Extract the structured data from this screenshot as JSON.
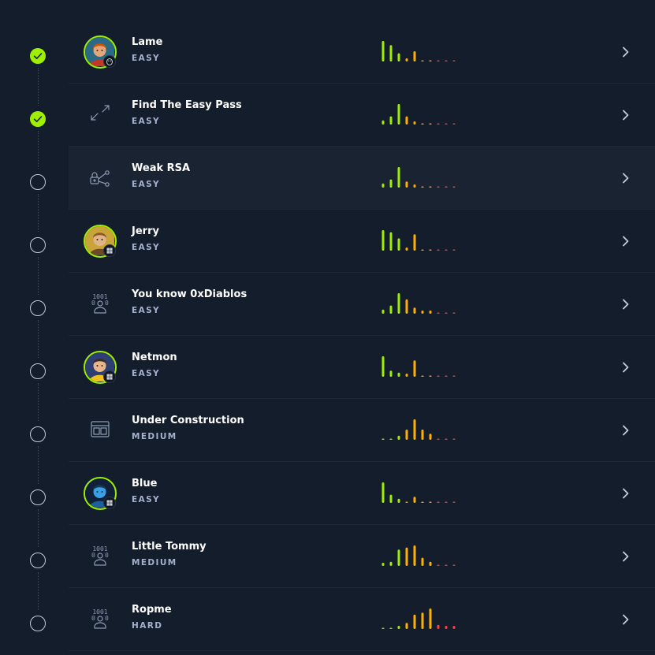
{
  "colors": {
    "background": "#141d2b",
    "highlight_row": "#1a2332",
    "accent_green": "#9fef00",
    "rating_green": "#9fef00",
    "rating_orange": "#ffaf00",
    "rating_red": "#ff3e3e",
    "title_text": "#ffffff",
    "difficulty_text": "#a4b1cd"
  },
  "items": [
    {
      "name": "Lame",
      "difficulty": "EASY",
      "completed": true,
      "icon": "lame-avatar",
      "os": "linux-icon",
      "rating": [
        10,
        8,
        4,
        1,
        5,
        0,
        0,
        0,
        0,
        0
      ]
    },
    {
      "name": "Find The Easy Pass",
      "difficulty": "EASY",
      "completed": true,
      "icon": "reversing-arrows-icon",
      "rating": [
        2,
        4,
        10,
        4,
        1,
        0,
        0,
        0,
        0,
        0
      ]
    },
    {
      "name": "Weak RSA",
      "difficulty": "EASY",
      "completed": false,
      "icon": "crypto-lock-icon",
      "highlighted": true,
      "rating": [
        2,
        4,
        10,
        3,
        1,
        0,
        0,
        0,
        0,
        0
      ]
    },
    {
      "name": "Jerry",
      "difficulty": "EASY",
      "completed": false,
      "icon": "jerry-avatar",
      "os": "windows-icon",
      "rating": [
        10,
        9,
        6,
        1,
        8,
        0,
        0,
        0,
        0,
        0
      ]
    },
    {
      "name": "You know 0xDiablos",
      "difficulty": "EASY",
      "completed": false,
      "icon": "pwn-binary-icon",
      "rating": [
        2,
        4,
        10,
        7,
        3,
        1,
        1,
        0,
        0,
        0
      ]
    },
    {
      "name": "Netmon",
      "difficulty": "EASY",
      "completed": false,
      "icon": "netmon-avatar",
      "os": "windows-icon",
      "rating": [
        10,
        3,
        2,
        1,
        8,
        0,
        0,
        0,
        0,
        0
      ]
    },
    {
      "name": "Under Construction",
      "difficulty": "MEDIUM",
      "completed": false,
      "icon": "web-window-icon",
      "rating": [
        0,
        0,
        2,
        5,
        10,
        5,
        3,
        0,
        0,
        0
      ]
    },
    {
      "name": "Blue",
      "difficulty": "EASY",
      "completed": false,
      "icon": "blue-avatar",
      "os": "windows-icon",
      "rating": [
        10,
        4,
        2,
        0,
        3,
        0,
        0,
        0,
        0,
        0
      ]
    },
    {
      "name": "Little Tommy",
      "difficulty": "MEDIUM",
      "completed": false,
      "icon": "pwn-binary-icon",
      "rating": [
        1,
        2,
        8,
        9,
        10,
        4,
        2,
        0,
        0,
        0
      ]
    },
    {
      "name": "Ropme",
      "difficulty": "HARD",
      "completed": false,
      "icon": "pwn-binary-icon",
      "rating": [
        0,
        0,
        1,
        3,
        7,
        8,
        10,
        2,
        1,
        1
      ]
    }
  ]
}
